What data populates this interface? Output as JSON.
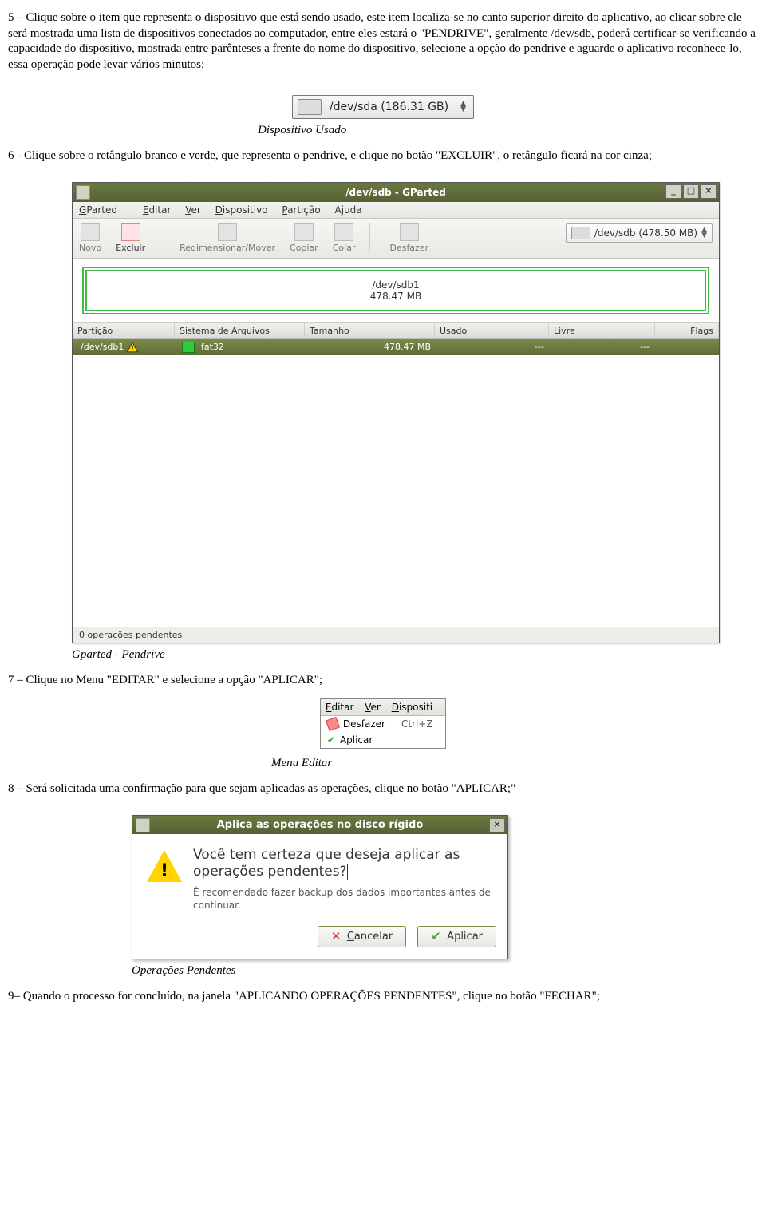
{
  "para5": "5 – Clique sobre o item que representa o dispositivo que está sendo usado, este item localiza-se no canto superior direito do aplicativo, ao clicar sobre ele será mostrada uma lista de dispositivos conectados ao computador, entre eles estará o \"PENDRIVE\", geralmente /dev/sdb, poderá certificar-se verificando a capacidade do dispositivo, mostrada entre parênteses a frente do nome do dispositivo, selecione a opção do pendrive e aguarde o aplicativo reconhece-lo, essa operação pode levar vários minutos;",
  "fig1": {
    "text": "/dev/sda  (186.31 GB)"
  },
  "cap1": "Dispositivo Usado",
  "para6": "6 - Clique sobre o retângulo branco e verde, que representa o pendrive, e clique no botão \"EXCLUIR\", o retângulo ficará na cor cinza;",
  "gp": {
    "title": "/dev/sdb - GParted",
    "menu": [
      "GParted",
      "Editar",
      "Ver",
      "Dispositivo",
      "Partição",
      "Ajuda"
    ],
    "tools": [
      "Novo",
      "Excluir",
      "Redimensionar/Mover",
      "Copiar",
      "Colar",
      "Desfazer"
    ],
    "device": "/dev/sdb (478.50 MB)",
    "vis": {
      "l1": "/dev/sdb1",
      "l2": "478.47 MB"
    },
    "cols": [
      "Partição",
      "Sistema de Arquivos",
      "Tamanho",
      "Usado",
      "Livre",
      "Flags"
    ],
    "row": {
      "p": "/dev/sdb1",
      "fs": "fat32",
      "size": "478.47 MB",
      "used": "---",
      "free": "---",
      "flags": ""
    },
    "status": "0 operações pendentes"
  },
  "cap2": "Gparted - Pendrive",
  "para7": "7 – Clique no Menu \"EDITAR\" e selecione a opção \"APLICAR\";",
  "edmenu": {
    "top": [
      "Editar",
      "Ver",
      "Dispositi"
    ],
    "undo": "Desfazer",
    "undoKb": "Ctrl+Z",
    "apply": "Aplicar"
  },
  "cap3": "Menu Editar",
  "para8": "8 – Será solicitada uma confirmação para que sejam aplicadas as operações, clique no botão \"APLICAR;\"",
  "dlg": {
    "title": "Aplica as operações no disco rígido",
    "h": "Você tem certeza que deseja aplicar as operações pendentes?",
    "p": "É recomendado fazer backup dos dados importantes antes de continuar.",
    "cancel": "Cancelar",
    "apply": "Aplicar"
  },
  "cap4": "Operações Pendentes",
  "para9": "9– Quando o processo for concluído, na janela \"APLICANDO OPERAÇÕES PENDENTES\", clique no botão \"FECHAR\";"
}
